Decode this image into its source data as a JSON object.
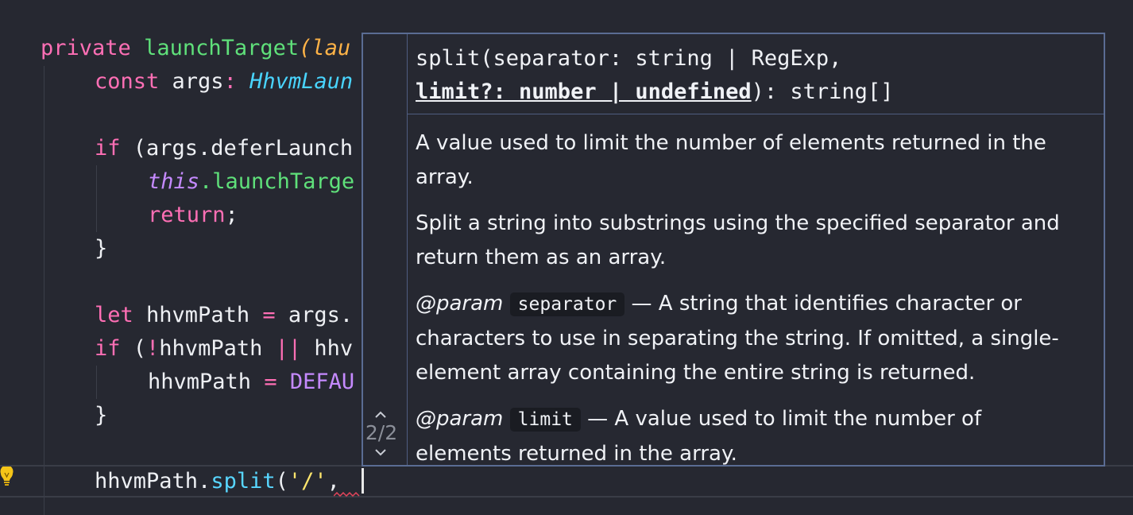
{
  "code": {
    "line1": {
      "kw": "private",
      "fn": "launchTarget",
      "paren": "(",
      "param": "lau"
    },
    "line2": {
      "kw": "const",
      "name": " args",
      "colon": ": ",
      "type": "HhvmLaun"
    },
    "line3": {
      "kw": "if",
      "rest": " (args.deferLaunch"
    },
    "line4": {
      "this": "this",
      "rest": ".launchTarge"
    },
    "line5": {
      "kw": "return",
      "rest": ";"
    },
    "line6": {
      "text": "}"
    },
    "line7": {
      "kw": "let",
      "name": " hhvmPath ",
      "op": "=",
      "rest": " args."
    },
    "line8": {
      "kw": "if",
      "p1": " (",
      "bang": "!",
      "name": "hhvmPath ",
      "op": "||",
      "rest": " hhv"
    },
    "line9": {
      "name": "hhvmPath ",
      "op": "=",
      "const": " DEFAU"
    },
    "line10": {
      "text": "}"
    },
    "line11": {
      "obj": "hhvmPath",
      "dot": ".",
      "method": "split",
      "open": "(",
      "str": "'/'",
      "comma": ", "
    }
  },
  "popup": {
    "signature": {
      "part1": "split(separator: string | RegExp,",
      "active_param": "limit?: number | undefined",
      "part2": "): string[]"
    },
    "counter": "2/2",
    "docs": {
      "param_desc": "A value used to limit the number of elements returned in the array.",
      "summary": "Split a string into substrings using the specified separator and return them as an array.",
      "param1": {
        "tag": "@param",
        "name": "separator",
        "desc": " — A string that identifies character or characters to use in separating the string. If omitted, a single-element array containing the entire string is returned."
      },
      "param2": {
        "tag": "@param",
        "name": "limit",
        "desc": " — A value used to limit the number of elements returned in the array."
      }
    }
  },
  "icons": [
    "lightbulb-icon",
    "chevron-up-icon",
    "chevron-down-icon"
  ],
  "colors": {
    "background": "#262831",
    "keyword": "#ff6fb5",
    "function": "#5fe07a",
    "popup_border": "#5a6c93"
  }
}
